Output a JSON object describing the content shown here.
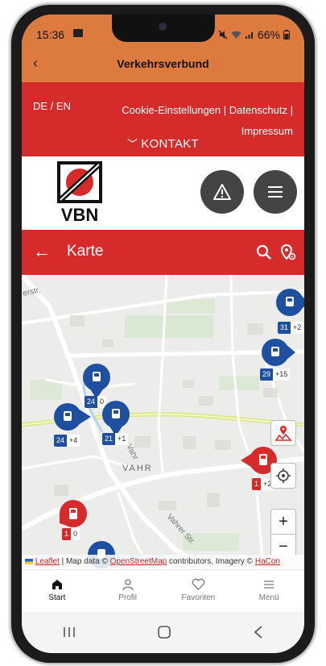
{
  "status": {
    "time": "15:36",
    "battery": "66%"
  },
  "appbar": {
    "title": "Verkehrsverbund"
  },
  "header": {
    "lang": "DE / EN",
    "links_line1": "Cookie-Einstellungen | Datenschutz |",
    "links_line2": "Impressum",
    "kontakt": "KONTAKT"
  },
  "logo": {
    "text": "VBN"
  },
  "page": {
    "title": "Karte"
  },
  "map": {
    "place_label": "VAHR",
    "street_label_1": "Vahr",
    "street_label_2": "Vahrer Str.",
    "street_label_3": "erstr.",
    "markers": [
      {
        "count": "31",
        "plus": "+2",
        "type": "bus"
      },
      {
        "count": "29",
        "plus": "+15",
        "type": "bus"
      },
      {
        "count": "24",
        "plus": "0",
        "type": "bus"
      },
      {
        "count": "24",
        "plus": "+4",
        "type": "bus"
      },
      {
        "count": "21",
        "plus": "+1",
        "type": "bus"
      },
      {
        "count": "1",
        "plus": "+2",
        "type": "tram"
      },
      {
        "count": "1",
        "plus": "0",
        "type": "tram"
      }
    ],
    "zoom_in": "+",
    "zoom_out": "−",
    "attribution": {
      "leaflet": "Leaflet",
      "mid": " | Map data © ",
      "osm": "OpenStreetMap",
      "tail": " contributors, Imagery © ",
      "hacon": "HaCon"
    }
  },
  "tabs": [
    {
      "label": "Start"
    },
    {
      "label": "Profil"
    },
    {
      "label": "Favoriten"
    },
    {
      "label": "Menü"
    }
  ],
  "colors": {
    "brand_red": "#d52b2b",
    "appbar_orange": "#dd7a3e",
    "bus_blue": "#1f4fa0",
    "tram_red": "#d52b2b"
  }
}
